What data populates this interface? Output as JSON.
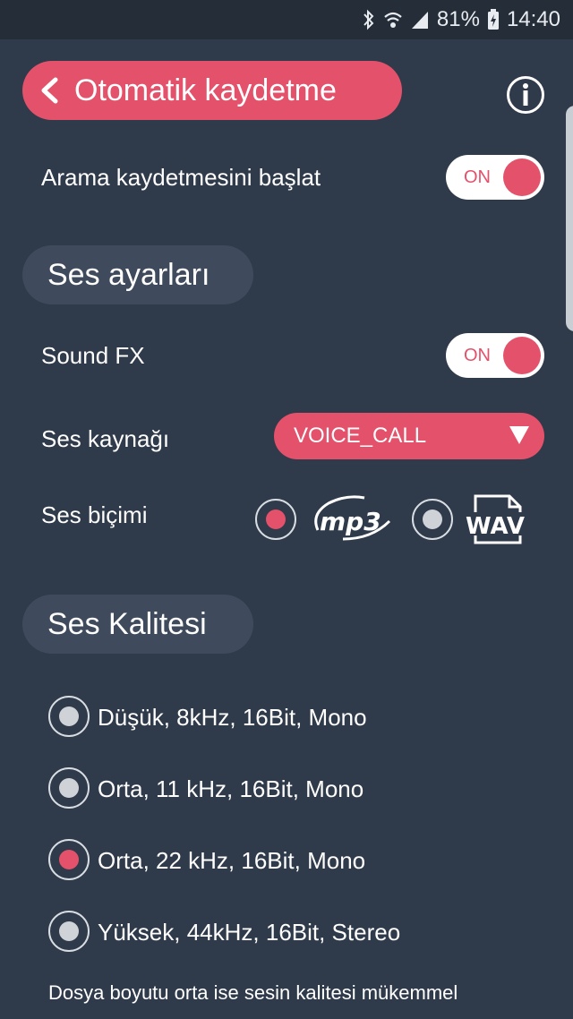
{
  "status_bar": {
    "battery": "81%",
    "time": "14:40"
  },
  "header": {
    "back_label": "Otomatik kaydetme"
  },
  "auto_record": {
    "label": "Arama kaydetmesini başlat",
    "toggle_text": "ON"
  },
  "sections": {
    "sound_settings": "Ses ayarları",
    "sound_quality": "Ses Kalitesi"
  },
  "sound_fx": {
    "label": "Sound FX",
    "toggle_text": "ON"
  },
  "source": {
    "label": "Ses kaynağı",
    "selected": "VOICE_CALL"
  },
  "format": {
    "label": "Ses biçimi",
    "options": [
      "mp3",
      "WAV"
    ],
    "selected": "mp3"
  },
  "quality": {
    "options": [
      "Düşük, 8kHz, 16Bit, Mono",
      "Orta, 11 kHz, 16Bit, Mono",
      "Orta, 22 kHz, 16Bit, Mono",
      "Yüksek, 44kHz, 16Bit, Stereo"
    ],
    "selected_index": 2
  },
  "footer_note": "Dosya boyutu orta ise sesin kalitesi mükemmel",
  "colors": {
    "accent": "#e4516a",
    "background": "#2f3a4a",
    "section_pill": "#3f4b5c"
  }
}
